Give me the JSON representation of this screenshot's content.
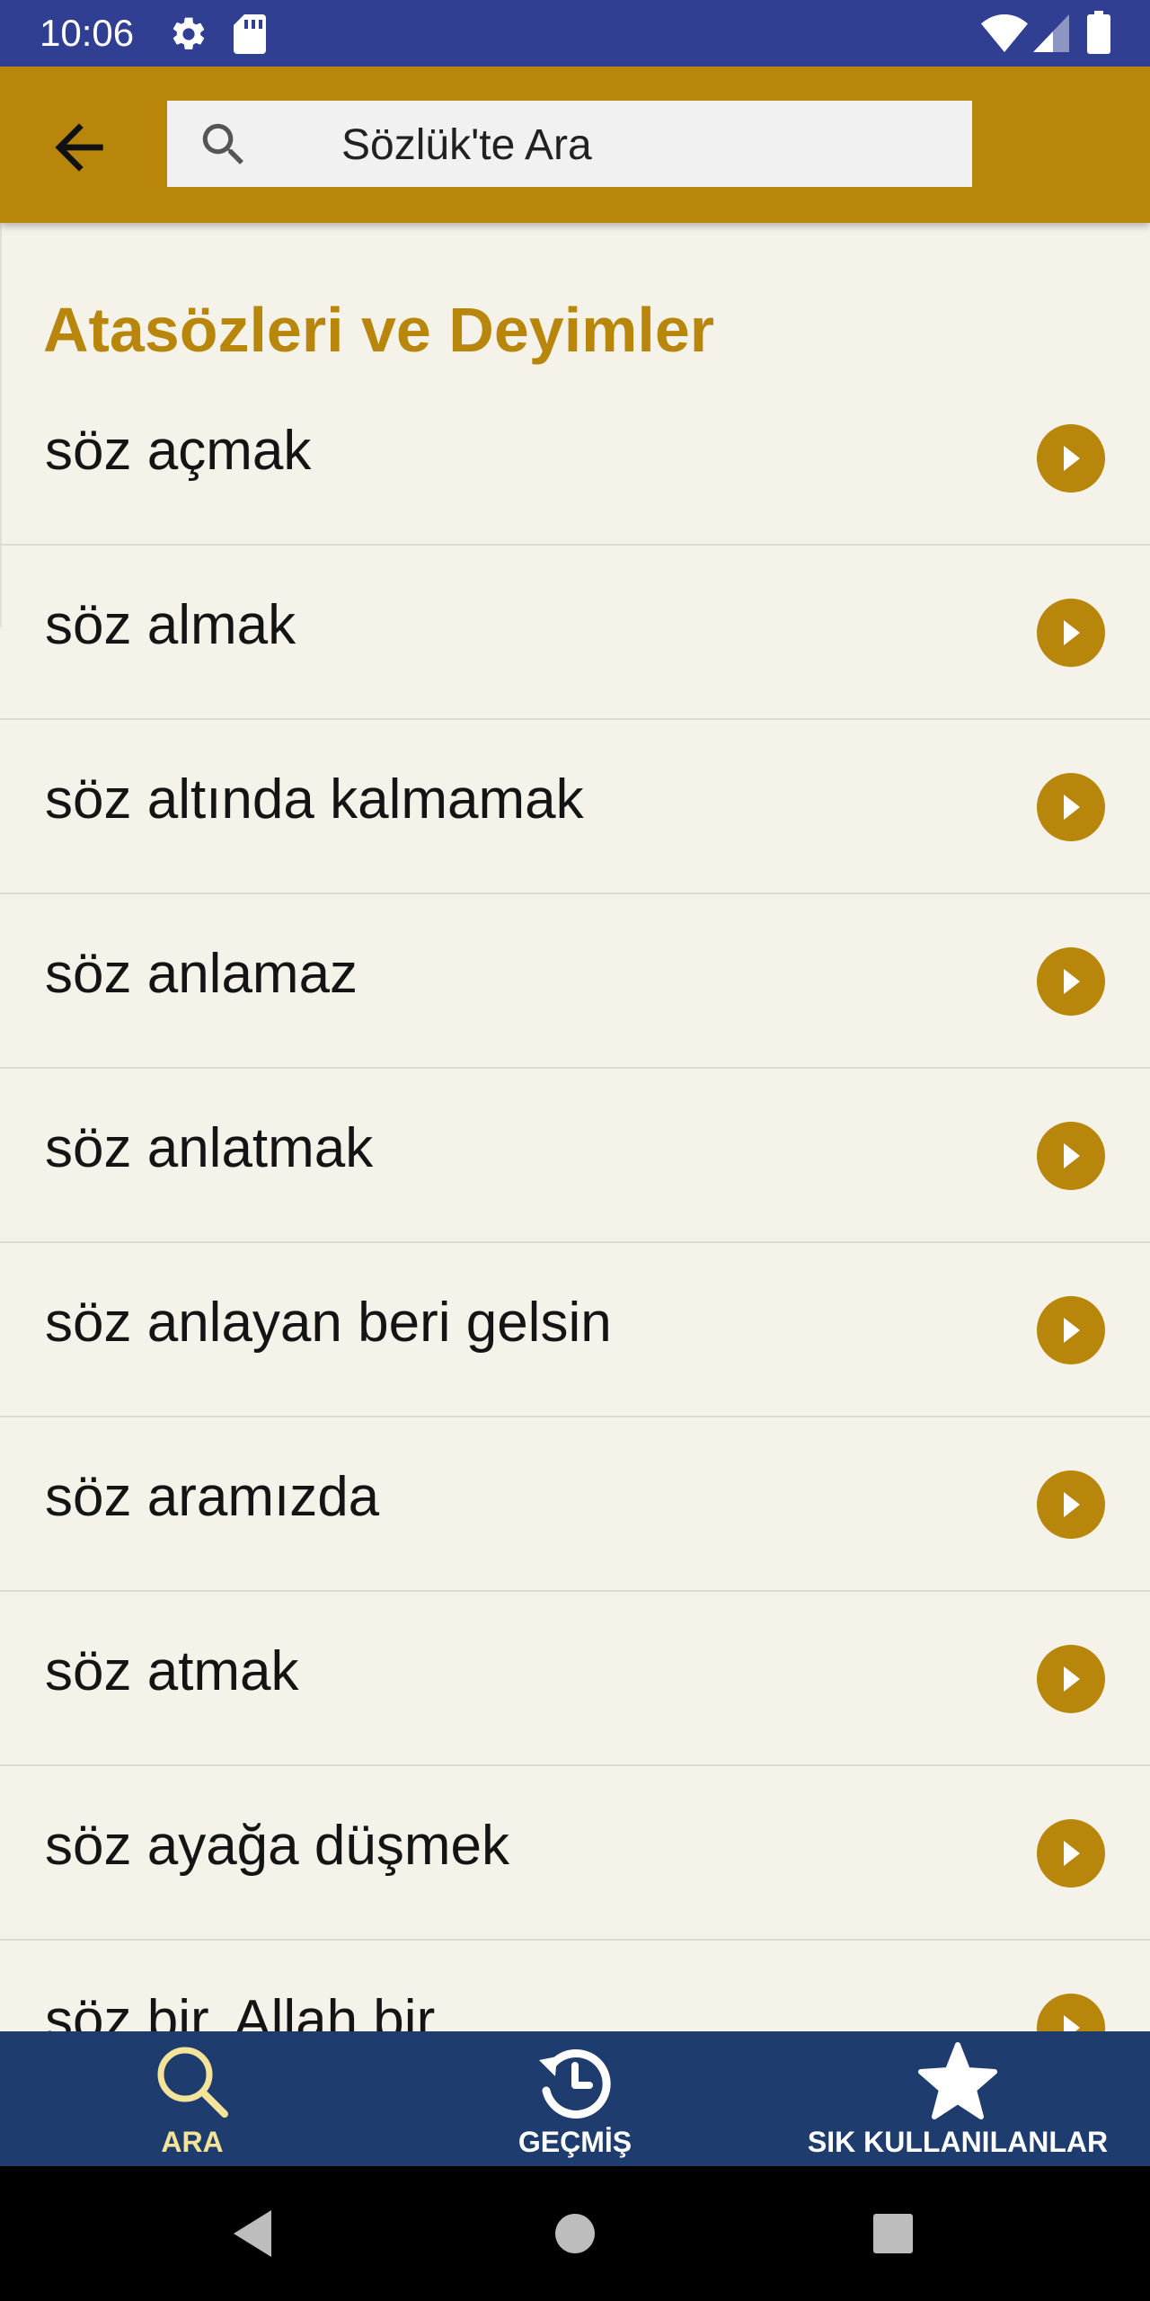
{
  "status_bar": {
    "time": "10:06",
    "left_icons": [
      "gear-icon",
      "sd-card-icon"
    ],
    "right_icons": [
      "wifi-icon",
      "signal-icon",
      "battery-icon"
    ]
  },
  "app_bar": {
    "back_icon": "arrow-left-icon",
    "search": {
      "icon": "search-icon",
      "placeholder": "Sözlük'te Ara"
    },
    "color": "#b8860b"
  },
  "section": {
    "title": "Atasözleri ve Deyimler"
  },
  "entries": [
    "söz açmak",
    "söz almak",
    "söz altında kalmamak",
    "söz anlamaz",
    "söz anlatmak",
    "söz anlayan beri gelsin",
    "söz aramızda",
    "söz atmak",
    "söz ayağa düşmek",
    "söz bir, Allah bir"
  ],
  "entry_action_icon": "play-circle-icon",
  "bottom_nav": {
    "items": [
      {
        "label": "ARA",
        "icon": "search-icon",
        "active": true
      },
      {
        "label": "GEÇMİŞ",
        "icon": "history-icon",
        "active": false
      },
      {
        "label": "SIK KULLANILANLAR",
        "icon": "star-icon",
        "active": false
      }
    ],
    "background": "#1e3c6e",
    "active_color": "#f4e49a",
    "inactive_color": "#ffffff"
  },
  "system_nav": {
    "buttons": [
      "back-triangle-icon",
      "home-circle-icon",
      "recents-square-icon"
    ]
  },
  "colors": {
    "status_bar": "#313f93",
    "accent": "#b8860b",
    "background": "#f5f3e9",
    "text": "#141414"
  }
}
